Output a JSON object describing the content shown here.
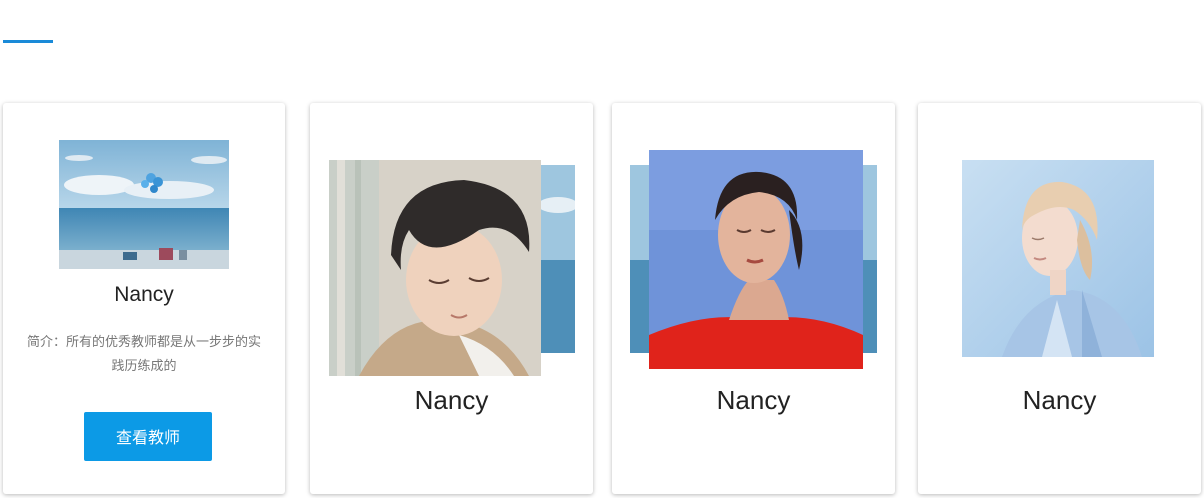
{
  "teachers": [
    {
      "name": "Nancy",
      "intro": "简介：所有的优秀教师都是从一步步的实践历练成的",
      "button_label": "查看教师",
      "photo": "beach-balloons-photo"
    },
    {
      "name": "Nancy",
      "photo": "young-man-portrait-photo"
    },
    {
      "name": "Nancy",
      "photo": "woman-red-sweater-portrait-photo"
    },
    {
      "name": "Nancy",
      "photo": "blonde-woman-blue-shirt-photo"
    }
  ],
  "colors": {
    "accent": "#1a8ad8",
    "button": "#0c9ae6"
  }
}
